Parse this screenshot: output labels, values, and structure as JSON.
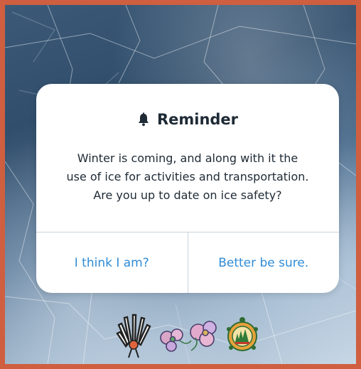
{
  "dialog": {
    "title": "Reminder",
    "title_icon": "bell-icon",
    "message_lines": [
      "Winter is coming, and along with it the",
      "use of ice for activities and transportation.",
      "Are you up to date on ice safety?"
    ],
    "buttons": {
      "left_label": "I think I am?",
      "right_label": "Better be sure."
    },
    "accent_color": "#2e8bd6"
  },
  "background": {
    "frame_color": "#cf5f40",
    "description_icon": "ice-texture"
  },
  "logos": [
    "headdress-logo",
    "floral-beadwork-logo",
    "turtle-trees-logo"
  ]
}
